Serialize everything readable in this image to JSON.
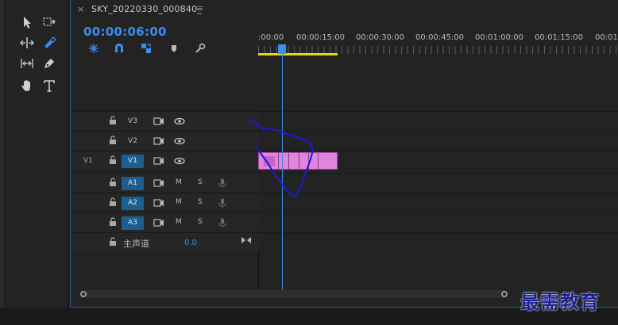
{
  "sequence": {
    "tab_close": "×",
    "tab_title": "SKY_20220330_000840_",
    "tab_menu": "≡",
    "timecode": "00:00:06:00"
  },
  "ruler": {
    "labels": [
      ":00:00",
      "00:00:15:00",
      "00:00:30:00",
      "00:00:45:00",
      "00:01:00:00",
      "00:01:15:00",
      "00:01:3"
    ]
  },
  "tracks": {
    "video": [
      {
        "name": "V3",
        "source": "",
        "active": false
      },
      {
        "name": "V2",
        "source": "",
        "active": false
      },
      {
        "name": "V1",
        "source": "V1",
        "active": true
      }
    ],
    "audio": [
      {
        "name": "A1",
        "m": "M",
        "s": "S"
      },
      {
        "name": "A2",
        "m": "M",
        "s": "S"
      },
      {
        "name": "A3",
        "m": "M",
        "s": "S"
      }
    ],
    "master": {
      "name": "主声道",
      "value": "0.0"
    }
  },
  "colors": {
    "accent": "#3b8eea",
    "clip": "#e084de",
    "workarea": "#e6d51a",
    "track_active": "#1b5e8f",
    "scribble": "#1a1adc"
  },
  "icons": {
    "tools": [
      "selection-tool-icon",
      "track-select-forward-icon",
      "ripple-edit-icon",
      "razor-tool-icon",
      "slip-tool-icon",
      "pen-tool-icon",
      "hand-tool-icon",
      "type-tool-icon"
    ],
    "controls": [
      "insert-sequence-nest-icon",
      "snap-icon",
      "linked-selection-icon",
      "add-marker-icon",
      "timeline-settings-icon"
    ]
  },
  "watermark": "最需教育"
}
